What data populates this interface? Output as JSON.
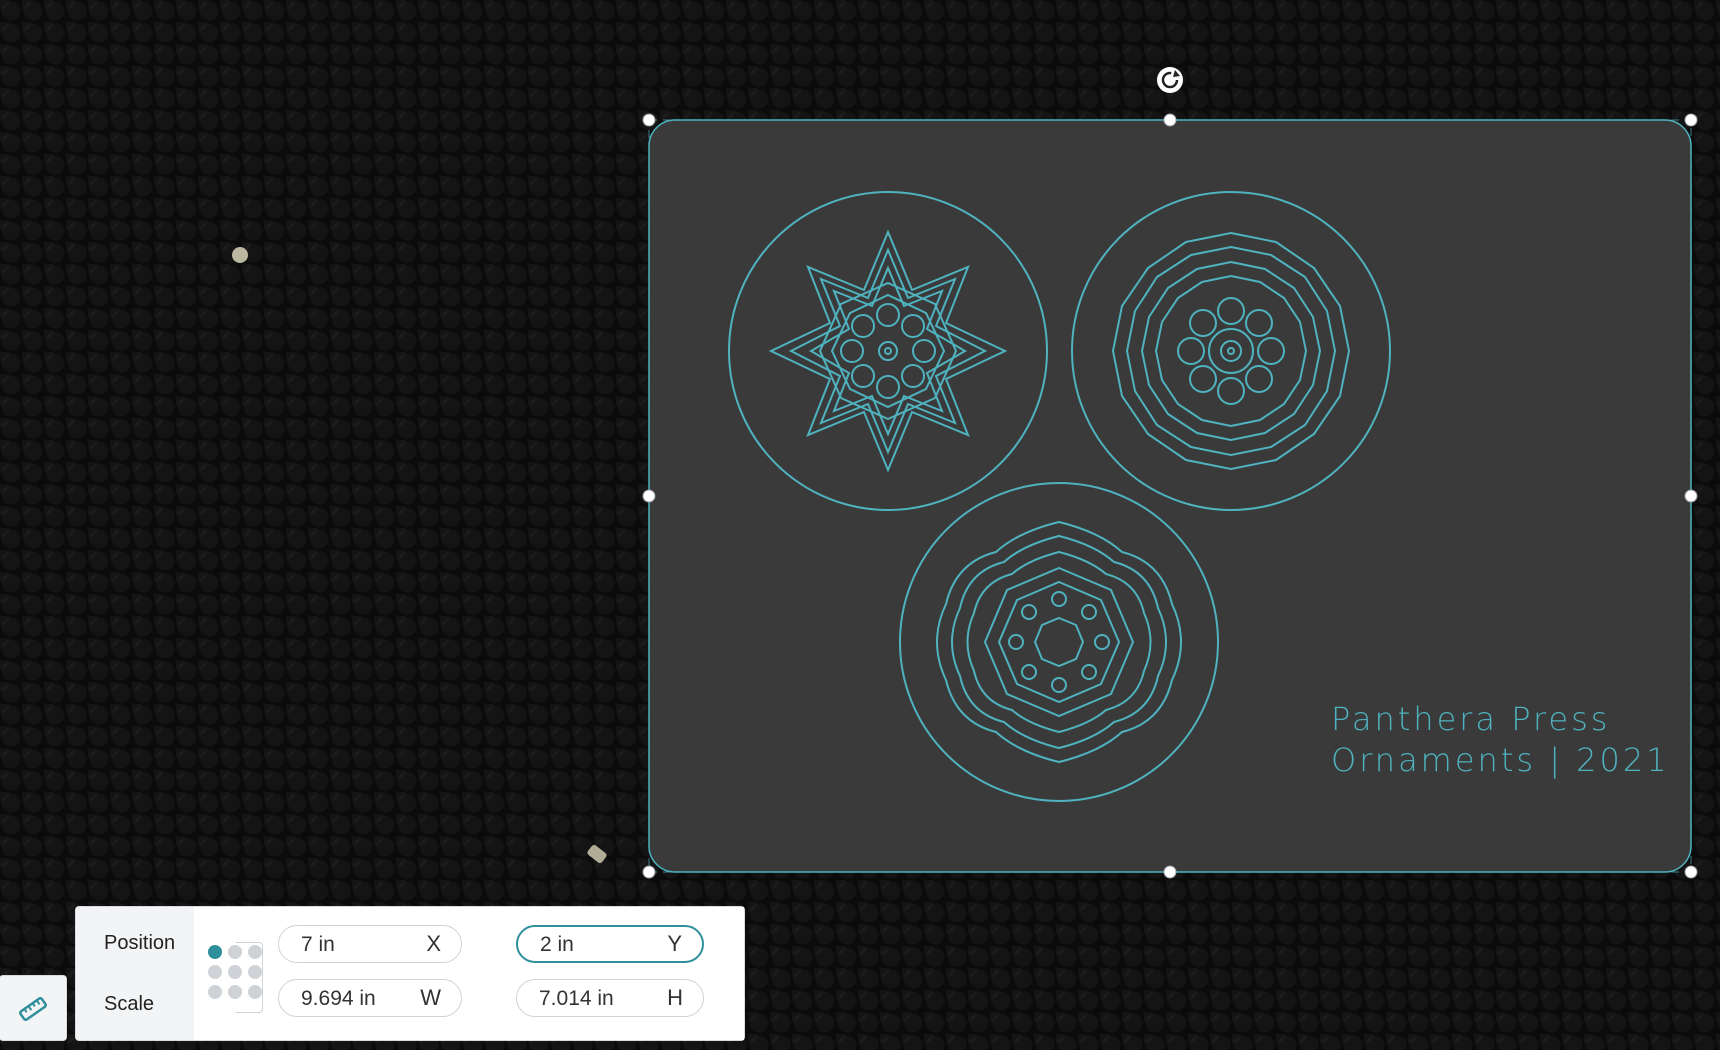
{
  "design": {
    "line1": "Panthera Press",
    "line2": "Ornaments | 2021",
    "stroke_color": "#4fb3bf",
    "card_fill": "#3a3a3a"
  },
  "panel": {
    "position_label": "Position",
    "scale_label": "Scale",
    "x_value": "7 in",
    "x_axis": "X",
    "y_value": "2 in",
    "y_axis": "Y",
    "w_value": "9.694 in",
    "w_axis": "W",
    "h_value": "7.014 in",
    "h_axis": "H",
    "accent": "#2f8f9b"
  },
  "icons": {
    "rotate": "rotate-icon",
    "link": "unlink-icon",
    "tool": "ruler-icon"
  }
}
